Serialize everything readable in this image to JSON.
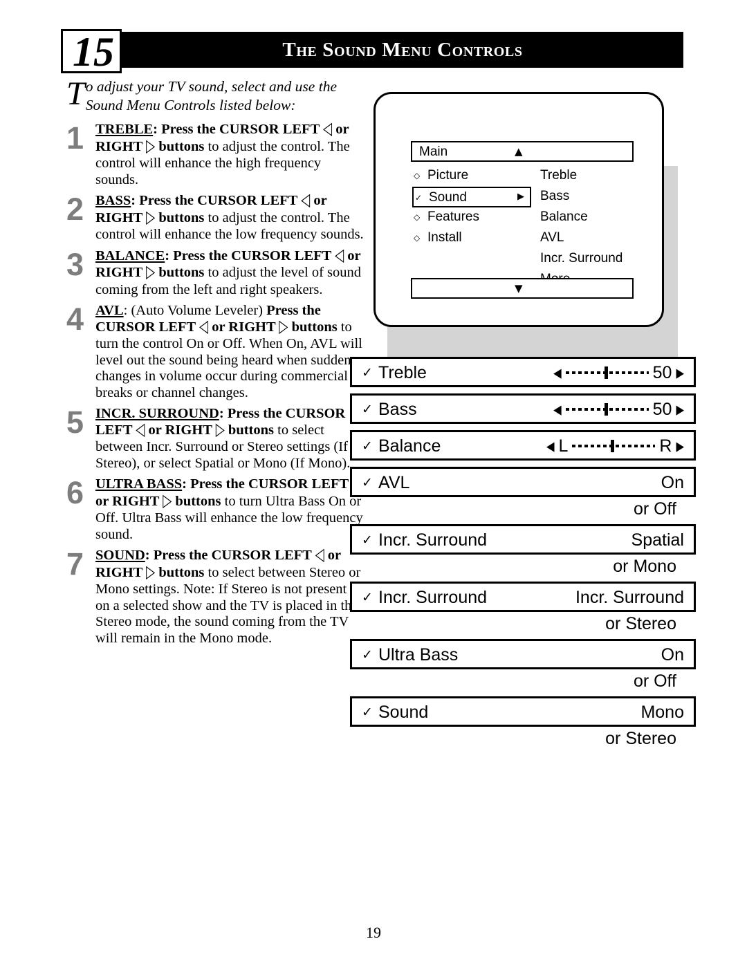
{
  "header": {
    "chapter_number": "15",
    "title": "The Sound Menu Controls"
  },
  "intro": {
    "drop_cap": "T",
    "text": "o adjust your TV sound, select and use the Sound Menu Controls listed below:"
  },
  "steps": [
    {
      "num": "1",
      "term": "TREBLE",
      "html": "<span class='ul'>TREBLE</span><b>: Press the CURSOR LEFT <span class='arrowl'>&#9665;</span> or RIGHT <span class='arrowr'>&#9655;</span> buttons</b> to adjust the control. The control will enhance the high frequency sounds."
    },
    {
      "num": "2",
      "term": "BASS",
      "html": "<span class='ul'>BASS</span><b>: Press the CURSOR LEFT <span class='arrowl'>&#9665;</span> or RIGHT <span class='arrowr'>&#9655;</span> buttons</b> to adjust the control. The control will enhance the low frequency sounds."
    },
    {
      "num": "3",
      "term": "BALANCE",
      "html": "<span class='ul'>BALANCE</span><b>: Press the CURSOR LEFT <span class='arrowl'>&#9665;</span> or RIGHT <span class='arrowr'>&#9655;</span> buttons</b> to adjust the level of sound coming from the left and right speakers."
    },
    {
      "num": "4",
      "term": "AVL",
      "html": "<span class='ul'>AVL</span>: (Auto Volume Leveler) <b>Press the CURSOR LEFT <span class='arrowl'>&#9665;</span> or RIGHT <span class='arrowr'>&#9655;</span> buttons</b> to turn the control On or Off. When On, AVL will level out the sound being heard when sudden changes in volume occur during commercial breaks or channel changes."
    },
    {
      "num": "5",
      "term": "INCR. SURROUND",
      "html": "<span class='ul'>INCR. SURROUND</span><b>: Press the CURSOR LEFT <span class='arrowl'>&#9665;</span> or RIGHT <span class='arrowr'>&#9655;</span> buttons</b> to select between Incr. Surround or Stereo settings (If Stereo), or select Spatial or Mono (If Mono)."
    },
    {
      "num": "6",
      "term": "ULTRA BASS",
      "html": "<span class='ul'>ULTRA BASS</span><b>: Press the CURSOR LEFT <span class='arrowl'>&#9665;</span> or RIGHT <span class='arrowr'>&#9655;</span> buttons</b> to turn Ultra Bass On or Off. Ultra Bass will enhance the low frequency sound."
    },
    {
      "num": "7",
      "term": "SOUND",
      "html": "<span class='ul'>SOUND</span><b>: Press the CURSOR LEFT <span class='arrowl'>&#9665;</span> or RIGHT <span class='arrowr'>&#9655;</span> buttons</b> to select between Stereo or Mono settings. Note: If Stereo is not present on a selected show and the TV is placed in the Stereo mode, the sound coming from the TV will remain in the Mono mode."
    }
  ],
  "osd": {
    "title": "Main",
    "up_arrow": "▲",
    "down_arrow": "▼",
    "left_items": [
      {
        "label": "Picture",
        "bullet": "◇",
        "selected": false
      },
      {
        "label": "Sound",
        "bullet": "✓",
        "selected": true,
        "arrow": "▶"
      },
      {
        "label": "Features",
        "bullet": "◇",
        "selected": false
      },
      {
        "label": "Install",
        "bullet": "◇",
        "selected": false
      }
    ],
    "right_items": [
      {
        "label": "Treble"
      },
      {
        "label": "Bass"
      },
      {
        "label": "Balance"
      },
      {
        "label": "AVL"
      },
      {
        "label": "Incr. Surround"
      },
      {
        "label": "More..."
      }
    ]
  },
  "controls": [
    {
      "id": "treble",
      "check": "✓",
      "label": "Treble",
      "kind": "slider",
      "value": "50",
      "left_arrow": "◀",
      "right_arrow": "▶",
      "sub": ""
    },
    {
      "id": "bass",
      "check": "✓",
      "label": "Bass",
      "kind": "slider",
      "value": "50",
      "left_arrow": "◀",
      "right_arrow": "▶",
      "sub": ""
    },
    {
      "id": "balance",
      "check": "✓",
      "label": "Balance",
      "kind": "balance",
      "left_mark": "L",
      "right_mark": "R",
      "left_arrow": "◀",
      "right_arrow": "▶",
      "sub": ""
    },
    {
      "id": "avl",
      "check": "✓",
      "label": "AVL",
      "kind": "value",
      "value": "On",
      "sub": "or Off"
    },
    {
      "id": "incr1",
      "check": "✓",
      "label": "Incr. Surround",
      "kind": "value",
      "value": "Spatial",
      "sub": "or Mono"
    },
    {
      "id": "incr2",
      "check": "✓",
      "label": "Incr. Surround",
      "kind": "value",
      "value": "Incr. Surround",
      "sub": "or Stereo"
    },
    {
      "id": "ultrabass",
      "check": "✓",
      "label": "Ultra Bass",
      "kind": "value",
      "value": "On",
      "sub": "or Off"
    },
    {
      "id": "sound",
      "check": "✓",
      "label": "Sound",
      "kind": "value",
      "value": "Mono",
      "sub": "or Stereo"
    }
  ],
  "page_number": "19"
}
